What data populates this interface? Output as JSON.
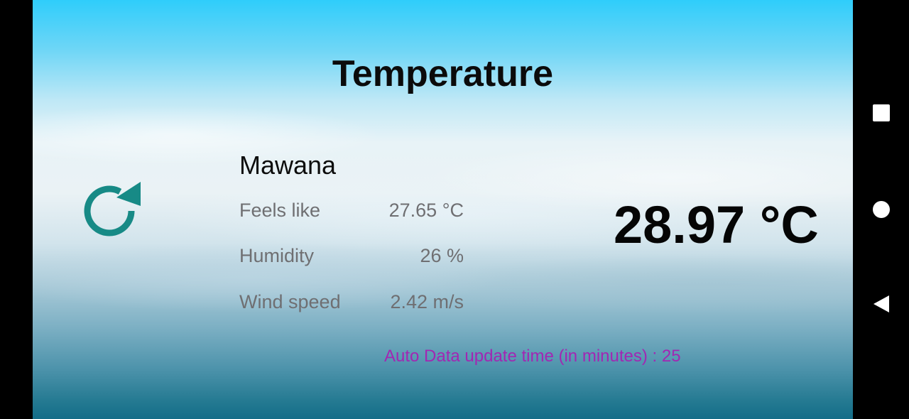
{
  "app": {
    "title": "Temperature",
    "city": "Mawana",
    "temperature": "28.97 °C",
    "details": [
      {
        "label": "Feels like",
        "value": "27.65 °C"
      },
      {
        "label": "Humidity",
        "value": "26 %"
      },
      {
        "label": "Wind speed",
        "value": "2.42 m/s"
      }
    ],
    "auto_update": "Auto Data update time (in minutes) : 25"
  },
  "icons": {
    "refresh": "refresh-icon",
    "recent_apps": "square-icon",
    "home": "circle-icon",
    "back": "triangle-back-icon"
  },
  "colors": {
    "refresh_icon": "#178a86",
    "auto_update_text": "#a227b3",
    "detail_text": "#6f6f72",
    "sky_top": "#2fcdfb",
    "sky_bottom": "#146d88"
  }
}
